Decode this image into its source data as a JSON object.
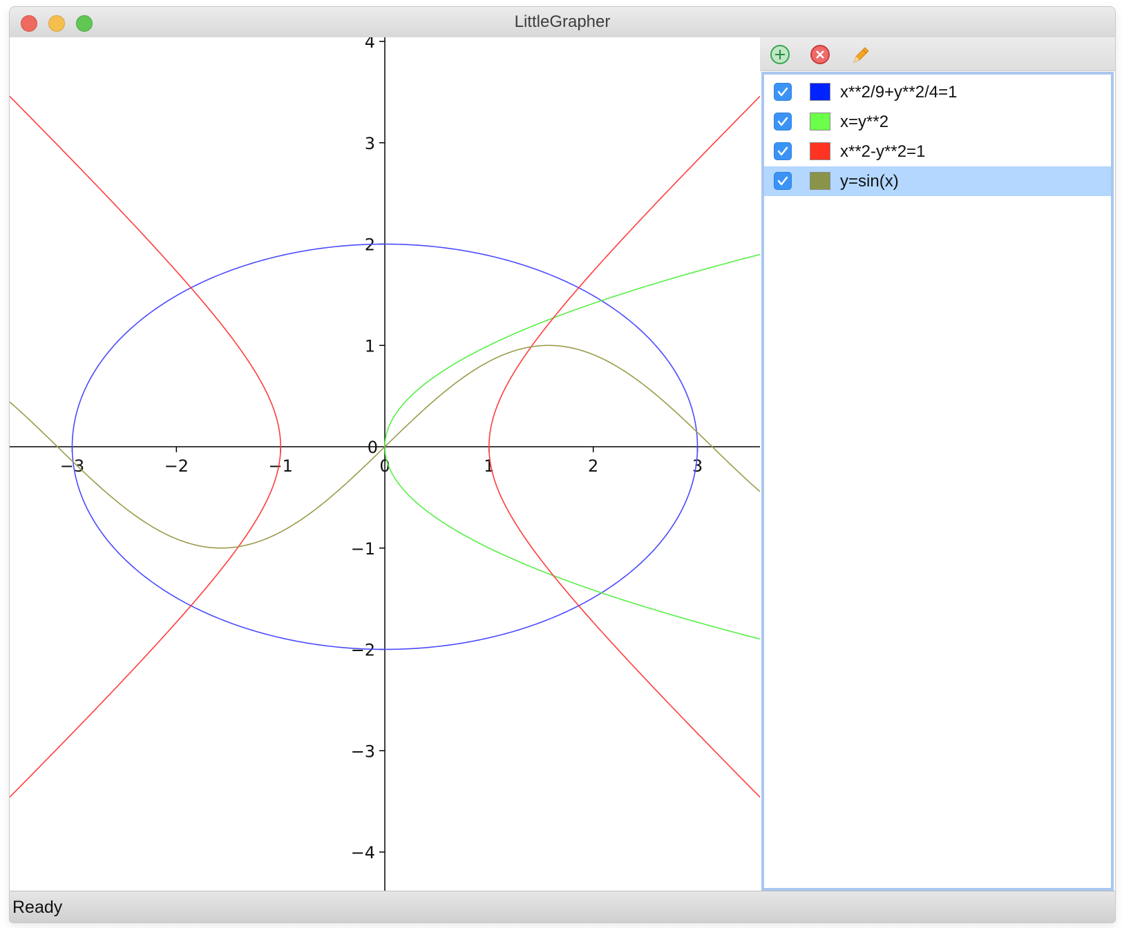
{
  "window": {
    "title": "LittleGrapher"
  },
  "toolbar": {
    "add_icon": "plus-circle-icon",
    "remove_icon": "x-circle-icon",
    "edit_icon": "pencil-icon"
  },
  "functions": [
    {
      "checked": true,
      "color": "#0022ff",
      "expression": "x**2/9+y**2/4=1",
      "selected": false
    },
    {
      "checked": true,
      "color": "#6cff4a",
      "expression": "x=y**2",
      "selected": false
    },
    {
      "checked": true,
      "color": "#ff3322",
      "expression": "x**2-y**2=1",
      "selected": false
    },
    {
      "checked": true,
      "color": "#8a9448",
      "expression": "y=sin(x)",
      "selected": true
    }
  ],
  "status": {
    "text": "Ready"
  },
  "chart_data": {
    "type": "line",
    "xlim": [
      -3.6,
      3.6
    ],
    "ylim": [
      -4,
      4
    ],
    "x_ticks": [
      -3,
      -2,
      -1,
      0,
      1,
      2,
      3
    ],
    "x_tick_labels": [
      "−3",
      "−2",
      "−1",
      "0",
      "1",
      "2",
      "3"
    ],
    "y_ticks": [
      -4,
      -3,
      -2,
      -1,
      0,
      1,
      2,
      3,
      4
    ],
    "y_tick_labels": [
      "−4",
      "−3",
      "−2",
      "−1",
      "0",
      "1",
      "2",
      "3",
      "4"
    ],
    "grid": false,
    "series": [
      {
        "equation": "x**2/9+y**2/4=1",
        "color": "#4a4aff"
      },
      {
        "equation": "x=y**2",
        "color": "#55f044"
      },
      {
        "equation": "x**2-y**2=1",
        "color": "#ff3b3b"
      },
      {
        "equation": "y=sin(x)",
        "color": "#9a9a4a"
      }
    ]
  }
}
